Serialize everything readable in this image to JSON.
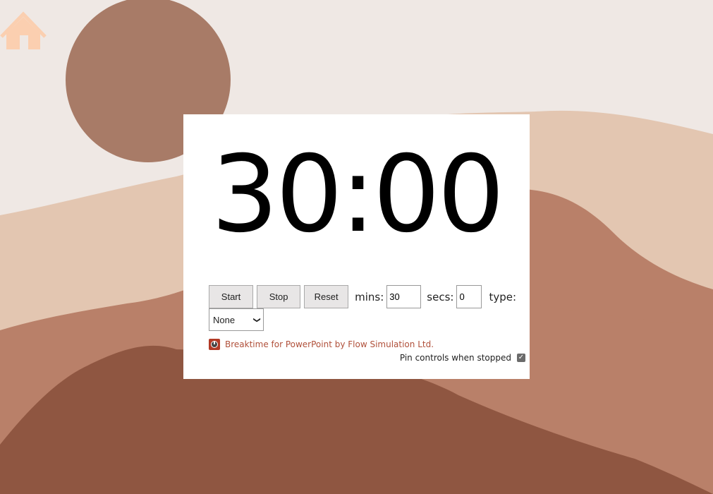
{
  "timer": {
    "display": "30:00"
  },
  "controls": {
    "start_label": "Start",
    "stop_label": "Stop",
    "reset_label": "Reset",
    "mins_label": "mins:",
    "mins_value": "30",
    "secs_label": "secs:",
    "secs_value": "0",
    "type_label": "type:",
    "type_selected": "None"
  },
  "credit": {
    "text": "Breaktime for PowerPoint by Flow Simulation Ltd."
  },
  "pin": {
    "label": "Pin controls when stopped",
    "checked": true
  },
  "icons": {
    "home": "home-icon",
    "clock": "clock-icon"
  },
  "colors": {
    "background": "#efe8e4",
    "sun": "#a87b67",
    "hill_light": "#e3c6b1",
    "hill_mid": "#b98069",
    "hill_dark": "#8f5641",
    "home_icon": "#fbcfb0",
    "credit_link": "#b0503a"
  }
}
